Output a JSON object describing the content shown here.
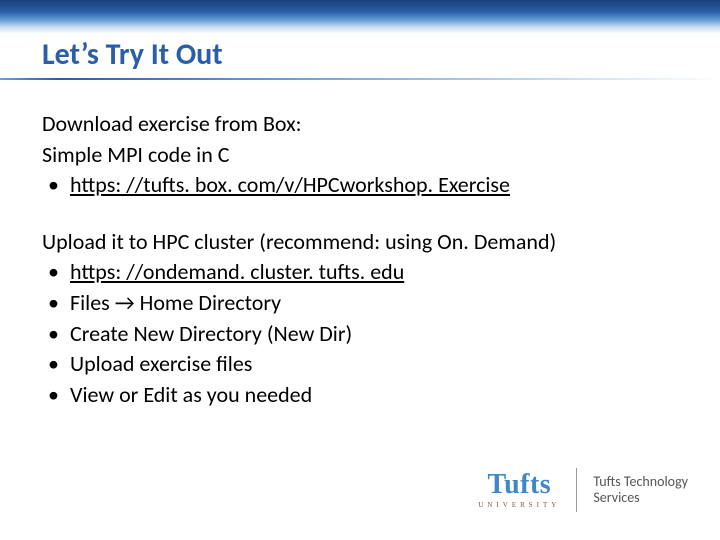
{
  "title": "Let’s Try It Out",
  "section1": {
    "lead1": "Download exercise from Box:",
    "lead2": "Simple MPI code in C",
    "items": [
      "https: //tufts. box. com/v/HPCworkshop. Exercise"
    ]
  },
  "section2": {
    "lead": "Upload it to HPC cluster (recommend: using On. Demand)",
    "items": [
      "https: //ondemand. cluster. tufts. edu",
      "Files → Home Directory",
      "Create New Directory (New Dir)",
      "Upload exercise files",
      "View or Edit as you needed"
    ]
  },
  "footer": {
    "tufts": "Tufts",
    "univ": "UNIVERSITY",
    "tts1": "Tufts Technology",
    "tts2": "Services"
  },
  "arrow_glyph": "→"
}
